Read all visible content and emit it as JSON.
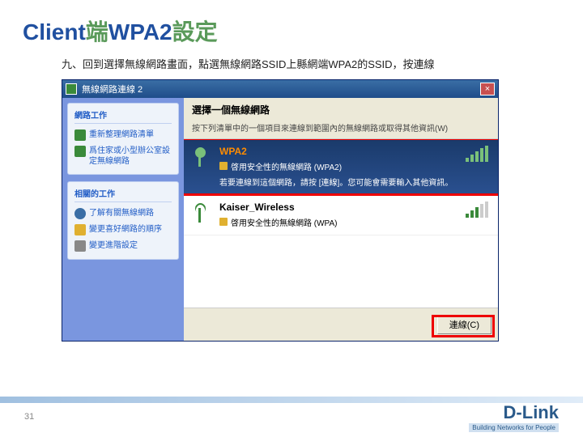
{
  "slide": {
    "title1": "Client",
    "title2": "端",
    "title3": "WPA2",
    "title4": "設定",
    "instruction": "九、回到選擇無線網路畫面，點選無線網路SSID上縣網端WPA2的SSID，按連線",
    "pageNum": "31"
  },
  "win": {
    "title": "無線網路連線 2"
  },
  "sidebar": {
    "panel1": {
      "title": "網路工作",
      "items": [
        "重新整理網路清單",
        "爲住家或小型辦公室設定無線網路"
      ]
    },
    "panel2": {
      "title": "相關的工作",
      "items": [
        "了解有關無線網路",
        "變更喜好網路的順序",
        "變更進階設定"
      ]
    }
  },
  "main": {
    "heading": "選擇一個無線網路",
    "sub": "按下列清單中的一個項目來連線到範圍內的無線網路或取得其他資訊(W)"
  },
  "nets": [
    {
      "name": "WPA2",
      "sec": "啓用安全性的無線網路 (WPA2)",
      "msg": "若要連線到這個網路，請按 [連線]。您可能會需要輸入其他資訊。"
    },
    {
      "name": "Kaiser_Wireless",
      "sec": "啓用安全性的無線網路 (WPA)",
      "msg": ""
    }
  ],
  "btn": {
    "connect": "連線(C)"
  },
  "brand": {
    "name": "D-Link",
    "tag": "Building Networks for People"
  }
}
